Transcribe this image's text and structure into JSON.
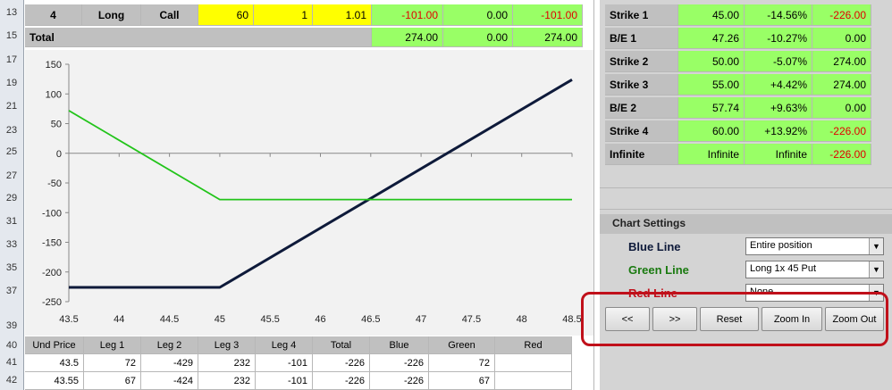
{
  "row_numbers": [
    "13",
    "15",
    "17",
    "19",
    "21",
    "23",
    "25",
    "27",
    "29",
    "31",
    "33",
    "35",
    "37",
    "39",
    "40",
    "41",
    "42"
  ],
  "top_row": {
    "leg": "4",
    "direction": "Long",
    "type": "Call",
    "strike": "60",
    "qty": "1",
    "price": "1.01",
    "v1": "-101.00",
    "v2": "0.00",
    "v3": "-101.00"
  },
  "total_row": {
    "label": "Total",
    "v1": "274.00",
    "v2": "0.00",
    "v3": "274.00"
  },
  "right_table": [
    {
      "label": "Strike 1",
      "price": "45.00",
      "pct": "-14.56%",
      "value": "-226.00",
      "neg": true
    },
    {
      "label": "B/E 1",
      "price": "47.26",
      "pct": "-10.27%",
      "value": "0.00",
      "neg": false
    },
    {
      "label": "Strike 2",
      "price": "50.00",
      "pct": "-5.07%",
      "value": "274.00",
      "neg": false
    },
    {
      "label": "Strike 3",
      "price": "55.00",
      "pct": "+4.42%",
      "value": "274.00",
      "neg": false
    },
    {
      "label": "B/E 2",
      "price": "57.74",
      "pct": "+9.63%",
      "value": "0.00",
      "neg": false
    },
    {
      "label": "Strike 4",
      "price": "60.00",
      "pct": "+13.92%",
      "value": "-226.00",
      "neg": true
    },
    {
      "label": "Infinite",
      "price": "Infinite",
      "pct": "Infinite",
      "value": "-226.00",
      "neg": true
    }
  ],
  "chart_settings": {
    "title": "Chart Settings",
    "blue_label": "Blue Line",
    "blue_value": "Entire position",
    "green_label": "Green Line",
    "green_value": "Long 1x 45 Put",
    "red_label": "Red Line",
    "red_value": "None"
  },
  "buttons": {
    "prev": "<<",
    "next": ">>",
    "reset": "Reset",
    "zoom_in": "Zoom In",
    "zoom_out": "Zoom Out"
  },
  "colors": {
    "blue_line": "#0e1a3a",
    "green_line": "#22c41a",
    "highlight": "#c0101a"
  },
  "chart_data": {
    "type": "line",
    "xlim": [
      43.5,
      48.5
    ],
    "ylim": [
      -250,
      150
    ],
    "x_ticks": [
      "43.5",
      "44",
      "44.5",
      "45",
      "45.5",
      "46",
      "46.5",
      "47",
      "47.5",
      "48",
      "48.5"
    ],
    "y_ticks": [
      "150",
      "100",
      "50",
      "0",
      "-50",
      "-100",
      "-150",
      "-200",
      "-250"
    ],
    "series": [
      {
        "color": "#0e1a3a",
        "x": [
          43.5,
          45.0,
          48.5
        ],
        "y": [
          -226,
          -226,
          124
        ]
      },
      {
        "color": "#22c41a",
        "x": [
          43.5,
          45.0,
          48.5
        ],
        "y": [
          72,
          -78,
          -78
        ]
      }
    ]
  },
  "bottom_table": {
    "headers": [
      "Und Price",
      "Leg 1",
      "Leg 2",
      "Leg 3",
      "Leg 4",
      "Total",
      "Blue",
      "Green",
      "Red"
    ],
    "rows": [
      [
        "43.5",
        "72",
        "-429",
        "232",
        "-101",
        "-226",
        "-226",
        "72",
        ""
      ],
      [
        "43.55",
        "67",
        "-424",
        "232",
        "-101",
        "-226",
        "-226",
        "67",
        ""
      ]
    ]
  }
}
